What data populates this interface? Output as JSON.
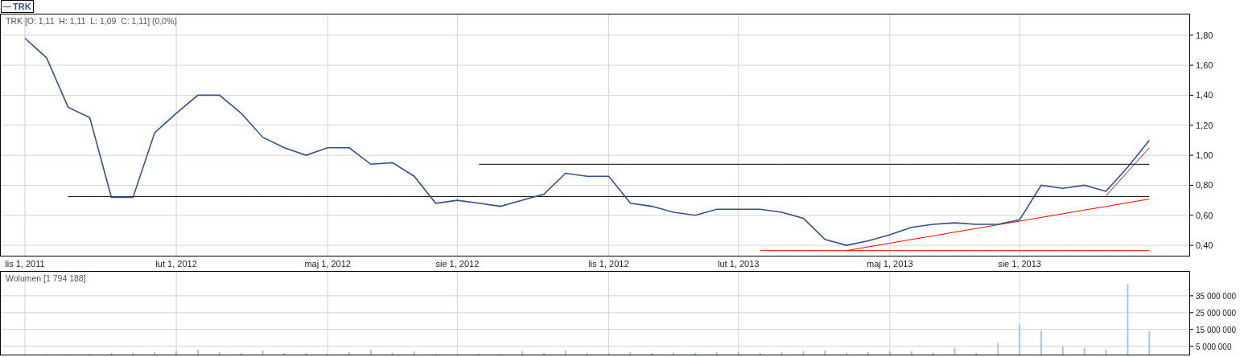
{
  "legend": {
    "label": "TRK"
  },
  "price_panel": {
    "readout": "TRK [O: 1,11  H: 1,11  L: 1,09  C: 1,11] (0,0%)",
    "chart_data": {
      "type": "line",
      "grid": true,
      "ylim": [
        0.331,
        1.938
      ],
      "categories": [
        "lis 1, 2011",
        null,
        null,
        null,
        null,
        null,
        null,
        "lut 1, 2012",
        null,
        null,
        null,
        null,
        null,
        null,
        "maj 1, 2012",
        null,
        null,
        null,
        null,
        null,
        "sie 1, 2012",
        null,
        null,
        null,
        null,
        null,
        null,
        "lis 1, 2012",
        null,
        null,
        null,
        null,
        null,
        "lut 1, 2013",
        null,
        null,
        null,
        null,
        null,
        null,
        "maj 1, 2013",
        null,
        null,
        null,
        null,
        null,
        "sie 1, 2013",
        null,
        null,
        null,
        null,
        null,
        null
      ],
      "series": [
        {
          "color": "#34508f",
          "values": [
            1.78,
            1.65,
            1.32,
            1.25,
            0.72,
            0.72,
            1.15,
            1.28,
            1.4,
            1.4,
            1.28,
            1.12,
            1.05,
            1.0,
            1.05,
            1.05,
            0.94,
            0.95,
            0.86,
            0.68,
            0.7,
            0.68,
            0.66,
            0.7,
            0.74,
            0.88,
            0.86,
            0.86,
            0.68,
            0.66,
            0.62,
            0.6,
            0.64,
            0.64,
            0.64,
            0.62,
            0.58,
            0.44,
            0.4,
            0.43,
            0.47,
            0.52,
            0.54,
            0.55,
            0.54,
            0.54,
            0.57,
            0.8,
            0.78,
            0.8,
            0.76,
            0.92,
            1.1
          ]
        },
        {
          "color": "#000000",
          "values": [
            null,
            null,
            0.725,
            0.725,
            0.725,
            0.725,
            0.725,
            0.725,
            0.725,
            0.725,
            0.725,
            0.725,
            0.725,
            0.725,
            0.725,
            0.725,
            0.725,
            0.725,
            0.725,
            0.725,
            0.725,
            0.725,
            0.725,
            0.725,
            0.725,
            0.725,
            0.725,
            0.725,
            0.725,
            0.725,
            0.725,
            0.725,
            0.725,
            0.725,
            0.725,
            0.725,
            0.725,
            0.725,
            0.725,
            0.725,
            0.725,
            0.725,
            0.725,
            0.725,
            0.725,
            0.725,
            0.725,
            0.725,
            0.725,
            0.725,
            0.725,
            0.725,
            0.725
          ]
        },
        {
          "color": "#000000",
          "values": [
            null,
            null,
            null,
            null,
            null,
            null,
            null,
            null,
            null,
            null,
            null,
            null,
            null,
            null,
            null,
            null,
            null,
            null,
            null,
            null,
            null,
            0.94,
            0.94,
            0.94,
            0.94,
            0.94,
            0.94,
            0.94,
            0.94,
            0.94,
            0.94,
            0.94,
            0.94,
            0.94,
            0.94,
            0.94,
            0.94,
            0.94,
            0.94,
            0.94,
            0.94,
            0.94,
            0.94,
            0.94,
            0.94,
            0.94,
            0.94,
            0.94,
            0.94,
            0.94,
            0.94,
            0.94,
            0.94
          ]
        },
        {
          "color": "#ff0000",
          "values": [
            null,
            null,
            null,
            null,
            null,
            null,
            null,
            null,
            null,
            null,
            null,
            null,
            null,
            null,
            null,
            null,
            null,
            null,
            null,
            null,
            null,
            null,
            null,
            null,
            null,
            null,
            null,
            null,
            null,
            null,
            null,
            null,
            null,
            null,
            0.365,
            0.365,
            0.365,
            0.365,
            0.365,
            0.365,
            0.365,
            0.365,
            0.365,
            0.365,
            0.365,
            0.365,
            0.365,
            0.365,
            0.365,
            0.365,
            0.365,
            0.365,
            0.365
          ]
        },
        {
          "color": "#ff0000",
          "values": [
            null,
            null,
            null,
            null,
            null,
            null,
            null,
            null,
            null,
            null,
            null,
            null,
            null,
            null,
            null,
            null,
            null,
            null,
            null,
            null,
            null,
            null,
            null,
            null,
            null,
            null,
            null,
            null,
            null,
            null,
            null,
            null,
            null,
            null,
            null,
            null,
            null,
            null,
            0.365,
            0.39,
            0.414,
            0.439,
            0.463,
            0.488,
            0.512,
            0.537,
            0.561,
            0.586,
            0.61,
            0.635,
            0.659,
            0.684,
            0.708
          ]
        },
        {
          "color": "#ff0000",
          "values": [
            null,
            null,
            null,
            null,
            null,
            null,
            null,
            null,
            null,
            null,
            null,
            null,
            null,
            null,
            null,
            null,
            null,
            null,
            null,
            null,
            null,
            null,
            null,
            null,
            null,
            null,
            null,
            null,
            null,
            null,
            null,
            null,
            null,
            null,
            null,
            null,
            null,
            null,
            null,
            null,
            null,
            null,
            null,
            null,
            null,
            null,
            null,
            null,
            null,
            null,
            0.73,
            0.89,
            1.05
          ]
        }
      ],
      "yticks": [
        {
          "value": 0.4,
          "label": "0,40"
        },
        {
          "value": 0.6,
          "label": "0,60"
        },
        {
          "value": 0.8,
          "label": "0,80"
        },
        {
          "value": 1.0,
          "label": "1,00"
        },
        {
          "value": 1.2,
          "label": "1,20"
        },
        {
          "value": 1.4,
          "label": "1,40"
        },
        {
          "value": 1.6,
          "label": "1,60"
        },
        {
          "value": 1.8,
          "label": "1,80"
        }
      ]
    }
  },
  "volume_panel": {
    "readout": "Wolumen [1 794 188]",
    "chart_data": {
      "type": "bar",
      "grid": true,
      "ylim": [
        0,
        49300000
      ],
      "categories": [
        null,
        null,
        null,
        null,
        null,
        null,
        null,
        null,
        null,
        null,
        null,
        null,
        null,
        null,
        null,
        null,
        null,
        null,
        null,
        null,
        null,
        null,
        null,
        null,
        null,
        null,
        null,
        null,
        null,
        null,
        null,
        null,
        null,
        null,
        null,
        null,
        null,
        null,
        null,
        null,
        null,
        null,
        null,
        null,
        null,
        null,
        null,
        null,
        null,
        null,
        null,
        null,
        null
      ],
      "series": [
        {
          "color": "#9ccaf5",
          "values": [
            300000,
            300000,
            300000,
            500000,
            1000000,
            1000000,
            1500000,
            2000000,
            3000000,
            1500000,
            1000000,
            2500000,
            1000000,
            1000000,
            500000,
            1500000,
            3000000,
            1000000,
            2000000,
            500000,
            400000,
            500000,
            500000,
            2000000,
            1000000,
            2500000,
            1000000,
            1000000,
            1500000,
            1000000,
            1000000,
            1000000,
            1500000,
            1500000,
            1000000,
            1500000,
            2000000,
            2500000,
            1000000,
            1500000,
            2000000,
            2000000,
            1000000,
            4000000,
            1000000,
            7000000,
            18000000,
            14000000,
            5000000,
            4000000,
            3000000,
            42000000,
            14000000
          ]
        }
      ],
      "yticks": [
        {
          "value": 5000000,
          "label": "5 000 000"
        },
        {
          "value": 15000000,
          "label": "15 000 000"
        },
        {
          "value": 25000000,
          "label": "25 000 000"
        },
        {
          "value": 35000000,
          "label": "35 000 000"
        }
      ]
    }
  }
}
